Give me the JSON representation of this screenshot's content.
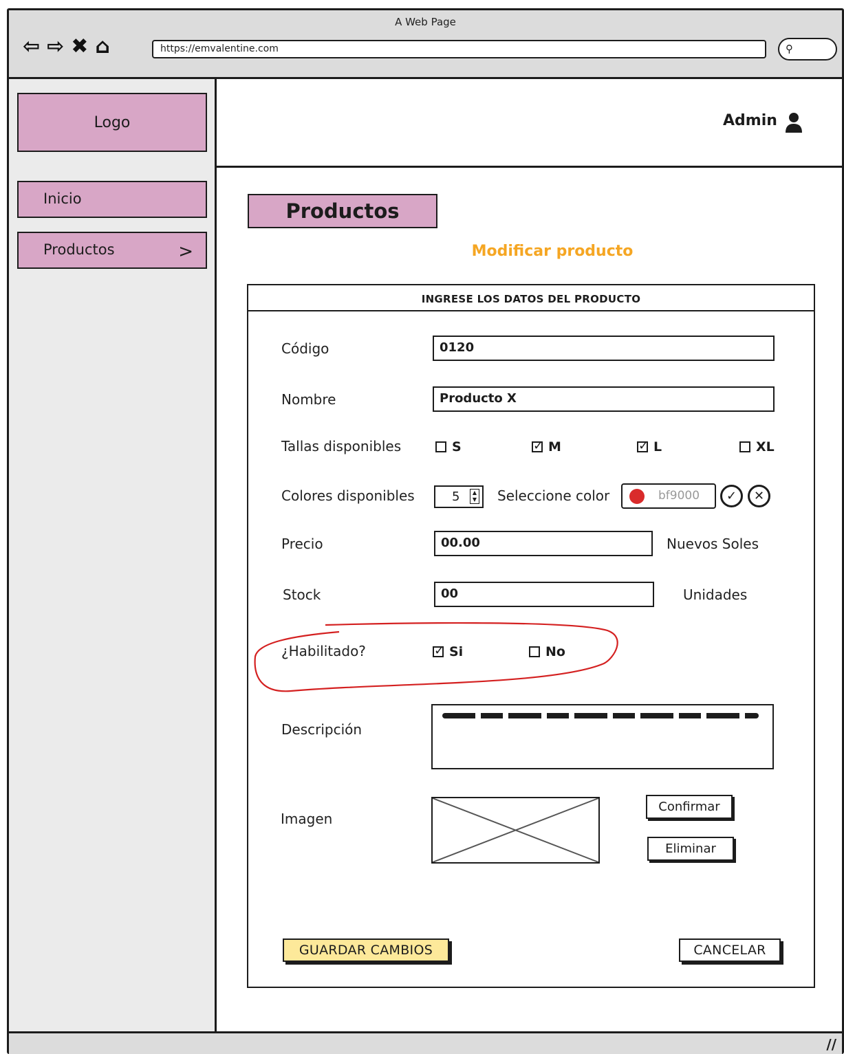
{
  "browser": {
    "window_title": "A Web Page",
    "url": "https://emvalentine.com",
    "nav_icons": [
      "back-arrow-icon",
      "forward-arrow-icon",
      "close-icon",
      "home-icon"
    ],
    "search_icon": "search-icon"
  },
  "sidebar": {
    "logo": "Logo",
    "items": [
      {
        "label": "Inicio"
      },
      {
        "label": "Productos",
        "icon": "chevron-right-icon"
      }
    ]
  },
  "header": {
    "user": "Admin",
    "user_icon": "user-icon"
  },
  "main": {
    "page_title": "Productos",
    "subtitle": "Modificar producto",
    "subtitle_color": "#f5a623",
    "form": {
      "header": "INGRESE LOS DATOS DEL PRODUCTO",
      "codigo": {
        "label": "Código",
        "value": "0120"
      },
      "nombre": {
        "label": "Nombre",
        "value": "Producto X"
      },
      "tallas": {
        "label": "Tallas disponibles",
        "options": [
          {
            "label": "S",
            "checked": false
          },
          {
            "label": "M",
            "checked": true
          },
          {
            "label": "L",
            "checked": true
          },
          {
            "label": "XL",
            "checked": false
          }
        ]
      },
      "colores": {
        "label": "Colores disponibles",
        "count": "5",
        "select_label": "Seleccione color",
        "hex": "bf9000",
        "swatch_color": "#d92b2b"
      },
      "precio": {
        "label": "Precio",
        "value": "00.00",
        "unit": "Nuevos Soles"
      },
      "stock": {
        "label": "Stock",
        "value": "00",
        "unit": "Unidades"
      },
      "habilitado": {
        "label": "¿Habilitado?",
        "options": [
          {
            "label": "Si",
            "checked": true
          },
          {
            "label": "No",
            "checked": false
          }
        ]
      },
      "descripcion": {
        "label": "Descripción"
      },
      "imagen": {
        "label": "Imagen",
        "confirm_button": "Confirmar",
        "delete_button": "Eliminar"
      },
      "save_button": "GUARDAR CAMBIOS",
      "cancel_button": "CANCELAR",
      "save_button_color": "#fde99a"
    }
  }
}
